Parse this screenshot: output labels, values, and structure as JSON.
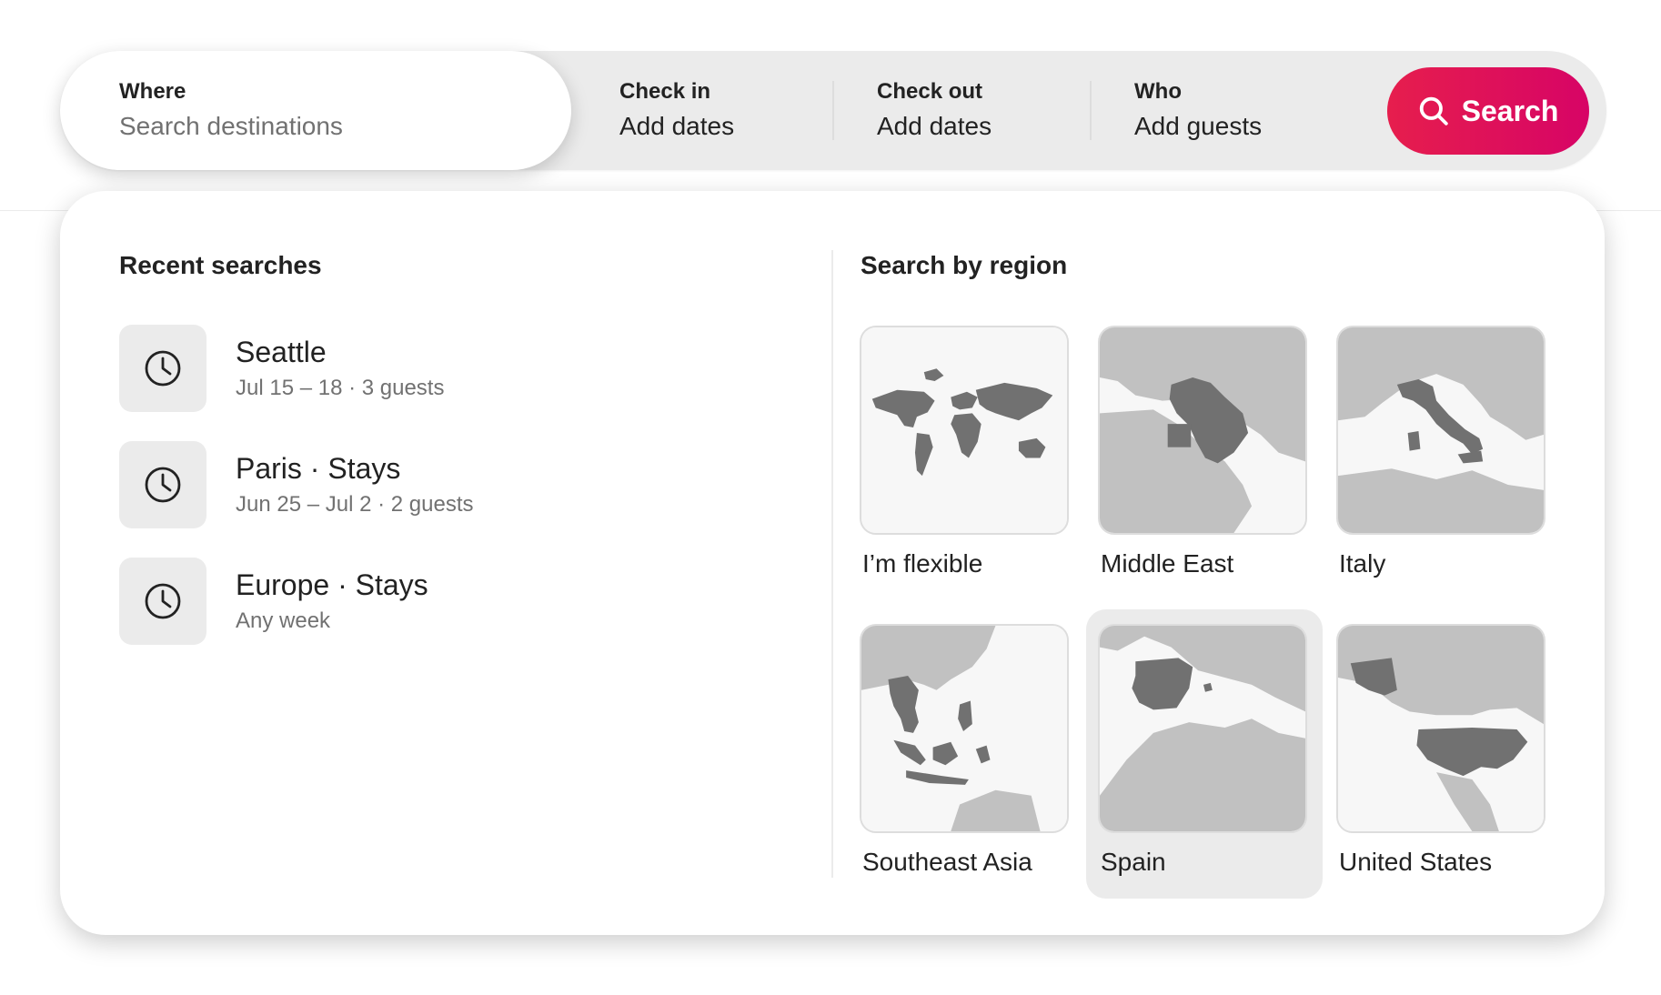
{
  "search_bar": {
    "where": {
      "label": "Where",
      "placeholder": "Search destinations"
    },
    "check_in": {
      "label": "Check in",
      "value": "Add dates"
    },
    "check_out": {
      "label": "Check out",
      "value": "Add dates"
    },
    "who": {
      "label": "Who",
      "value": "Add guests"
    },
    "search_button_label": "Search",
    "accent_color_start": "#e61e4d",
    "accent_color_end": "#d70466"
  },
  "recent": {
    "title": "Recent searches",
    "items": [
      {
        "title": "Seattle",
        "subtitle": "Jul 15 – 18 · 3 guests",
        "icon": "clock-icon"
      },
      {
        "title": "Paris · Stays",
        "subtitle": "Jun 25 – Jul 2 · 2 guests",
        "icon": "clock-icon"
      },
      {
        "title": "Europe · Stays",
        "subtitle": "Any week",
        "icon": "clock-icon"
      }
    ]
  },
  "regions": {
    "title": "Search by region",
    "items": [
      {
        "label": "I’m flexible",
        "icon": "world-map-icon",
        "selected": false
      },
      {
        "label": "Middle East",
        "icon": "middle-east-map-icon",
        "selected": false
      },
      {
        "label": "Italy",
        "icon": "italy-map-icon",
        "selected": false
      },
      {
        "label": "Southeast Asia",
        "icon": "southeast-asia-map-icon",
        "selected": false
      },
      {
        "label": "Spain",
        "icon": "spain-map-icon",
        "selected": true
      },
      {
        "label": "United States",
        "icon": "united-states-map-icon",
        "selected": false
      }
    ]
  }
}
